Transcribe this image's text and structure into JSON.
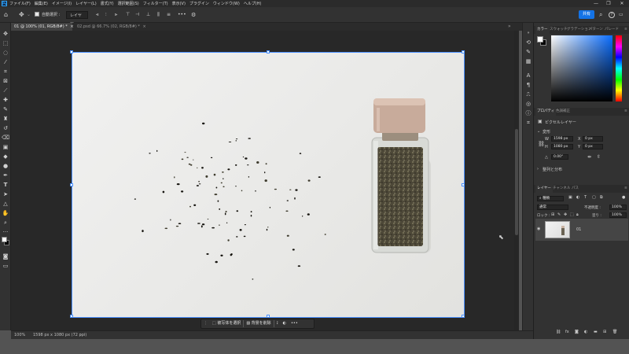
{
  "menubar": {
    "logo": "Ps",
    "items": [
      "ファイル(F)",
      "編集(E)",
      "イメージ(I)",
      "レイヤー(L)",
      "書式(Y)",
      "選択範囲(S)",
      "フィルター(T)",
      "表示(V)",
      "プラグイン",
      "ウィンドウ(W)",
      "ヘルプ(H)"
    ],
    "minimize": "—",
    "maximize": "❐",
    "close": "✕"
  },
  "options": {
    "home_icon": "⌂",
    "move_icon": "✥",
    "auto_select_label": "自動選択 :",
    "auto_select_target": "レイヤー",
    "more": "•••",
    "gear": "⚙",
    "share_label": "共有",
    "search_icon": "⌕",
    "help_icon": "?",
    "arrange_icon": "▭"
  },
  "doc_tabs": [
    {
      "label": "01 @ 100% (01, RGB/8#) *",
      "close": "×"
    },
    {
      "label": "02.psd @ 66.7% (02, RGB/8#) *",
      "close": "×"
    }
  ],
  "status": {
    "zoom": "100%",
    "doc_info": "1598 px x 1080 px (72 ppi)",
    "chevron": "›"
  },
  "taskbar": {
    "select_subject": "被写体を選択",
    "remove_bg": "背景を削除",
    "more": "•••"
  },
  "panels": {
    "color_tabs": [
      "カラー",
      "スウォッチ",
      "グラデーション",
      "パターン",
      "パレード"
    ],
    "props_tabs": [
      "プロパティ",
      "色調補正"
    ],
    "layer_kind": "ピクセルレイヤー",
    "transform_label": "変形",
    "w_label": "W",
    "w_value": "1598 px",
    "h_label": "H",
    "h_value": "1080 px",
    "x_label": "X",
    "x_value": "0 px",
    "y_label": "Y",
    "y_value": "0 px",
    "angle_label": "△",
    "angle_value": "0.00°",
    "align_label": "整列と分布",
    "layers_tabs": [
      "レイヤー",
      "チャンネル",
      "パス"
    ],
    "filter_kind": "種類",
    "blend_mode": "通常",
    "opacity_label": "不透明度 :",
    "opacity_value": "100%",
    "lock_label": "ロック :",
    "fill_label": "塗り :",
    "fill_value": "100%",
    "layer_name": "01",
    "eye_icon": "👁"
  },
  "colors": {
    "accent": "#1473e6",
    "selection": "#4a90ff",
    "foreground": "#ffffff",
    "background": "#000000"
  },
  "icons": [
    "home-icon",
    "move-icon",
    "marquee-icon",
    "lasso-icon",
    "magic-wand-icon",
    "crop-icon",
    "frame-icon",
    "eyedropper-icon",
    "healing-icon",
    "brush-icon",
    "stamp-icon",
    "history-brush-icon",
    "eraser-icon",
    "gradient-icon",
    "blur-icon",
    "dodge-icon",
    "pen-icon",
    "type-icon",
    "path-select-icon",
    "shape-icon",
    "hand-icon",
    "zoom-icon",
    "more-tools-icon",
    "quick-mask-icon",
    "screen-mode-icon"
  ]
}
